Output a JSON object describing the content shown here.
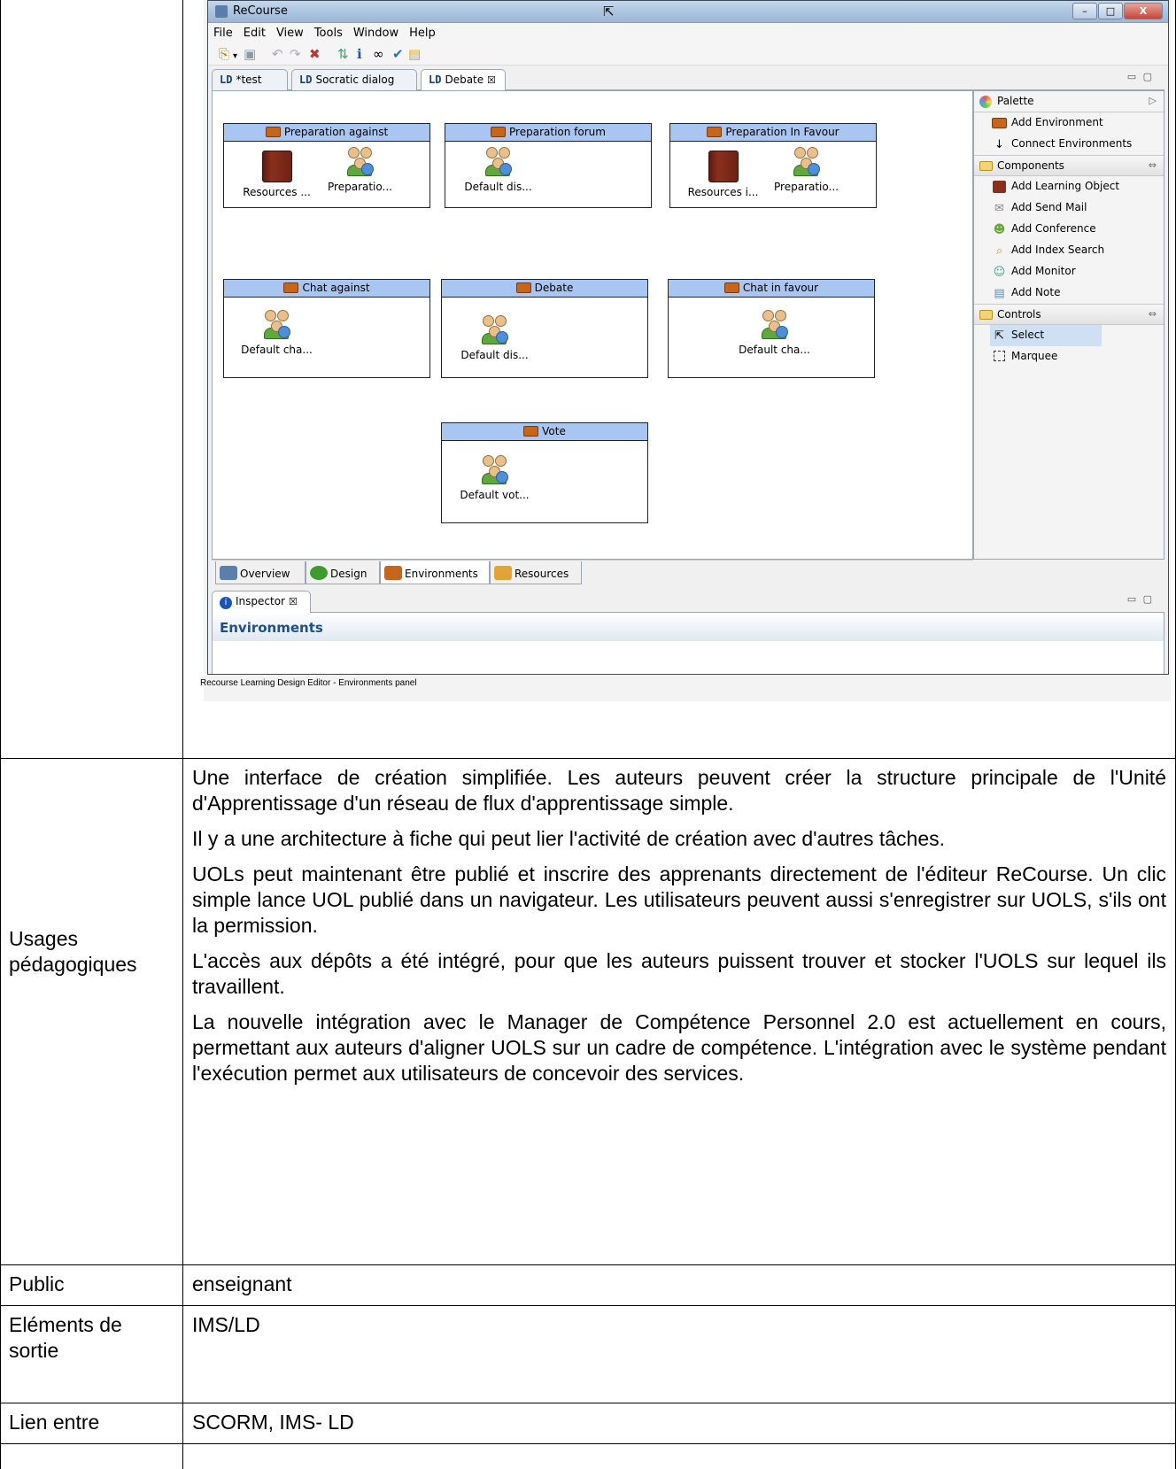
{
  "window": {
    "title": "ReCourse",
    "minimize": "–",
    "maximize": "□",
    "close": "X"
  },
  "menu": [
    "File",
    "Edit",
    "View",
    "Tools",
    "Window",
    "Help"
  ],
  "editor_tabs": [
    {
      "prefix": "LD",
      "label": "*test"
    },
    {
      "prefix": "LD",
      "label": "Socratic dialog"
    },
    {
      "prefix": "LD",
      "label": "Debate",
      "close": "☒"
    }
  ],
  "environments": [
    {
      "title": "Preparation against",
      "items": [
        "Resources ...",
        "Preparatio..."
      ]
    },
    {
      "title": "Preparation forum",
      "items": [
        "Default dis..."
      ]
    },
    {
      "title": "Preparation In Favour",
      "items": [
        "Resources i...",
        "Preparatio..."
      ]
    },
    {
      "title": "Chat against",
      "items": [
        "Default cha..."
      ]
    },
    {
      "title": "Debate",
      "items": [
        "Default dis..."
      ]
    },
    {
      "title": "Chat in favour",
      "items": [
        "Default cha..."
      ]
    },
    {
      "title": "Vote",
      "items": [
        "Default vot..."
      ]
    }
  ],
  "palette": {
    "header": "Palette",
    "items": [
      {
        "label": "Add Environment",
        "icon": "briefcase-icon"
      },
      {
        "label": "Connect Environments",
        "icon": "connect-arrow-icon"
      }
    ],
    "components_header": "Components",
    "components": [
      {
        "label": "Add Learning Object",
        "icon": "book-icon"
      },
      {
        "label": "Add Send Mail",
        "icon": "mail-icon"
      },
      {
        "label": "Add Conference",
        "icon": "conference-icon"
      },
      {
        "label": "Add Index Search",
        "icon": "index-search-icon"
      },
      {
        "label": "Add Monitor",
        "icon": "monitor-icon"
      },
      {
        "label": "Add Note",
        "icon": "note-icon"
      }
    ],
    "controls_header": "Controls",
    "controls": [
      {
        "label": "Select",
        "icon": "pointer-icon"
      },
      {
        "label": "Marquee",
        "icon": "marquee-icon"
      }
    ]
  },
  "bottom_tabs": [
    "Overview",
    "Design",
    "Environments",
    "Resources"
  ],
  "inspector": {
    "tab": "Inspector",
    "close": "☒",
    "heading": "Environments"
  },
  "caption": "Recourse Learning Design Editor - Environments panel",
  "table": {
    "rows": [
      {
        "label": "Usages pédagogiques",
        "paragraphs": [
          "Une interface de création simplifiée. Les auteurs peuvent créer la structure principale de l'Unité d'Apprentissage d'un réseau de flux d'apprentissage simple.",
          "Il y a une architecture à fiche qui peut lier l'activité de création avec d'autres tâches.",
          "UOLs peut maintenant être publié et inscrire des apprenants directement de l'éditeur ReCourse. Un clic simple lance UOL publié dans un navigateur. Les utilisateurs peuvent aussi s'enregistrer sur UOLS, s'ils ont la permission.",
          "L'accès aux dépôts a été intégré, pour que les auteurs puissent trouver et stocker l'UOLS sur lequel ils travaillent.",
          "La nouvelle intégration avec le Manager de Compétence Personnel 2.0 est actuellement en cours, permettant aux auteurs d'aligner UOLS sur un cadre de compétence. L'intégration avec le système pendant l'exécution permet aux utilisateurs de concevoir des services."
        ]
      },
      {
        "label": "Public",
        "value": "enseignant"
      },
      {
        "label": "Eléments de sortie",
        "value": "IMS/LD"
      },
      {
        "label": "Lien entre",
        "value": "SCORM, IMS- LD"
      }
    ]
  }
}
